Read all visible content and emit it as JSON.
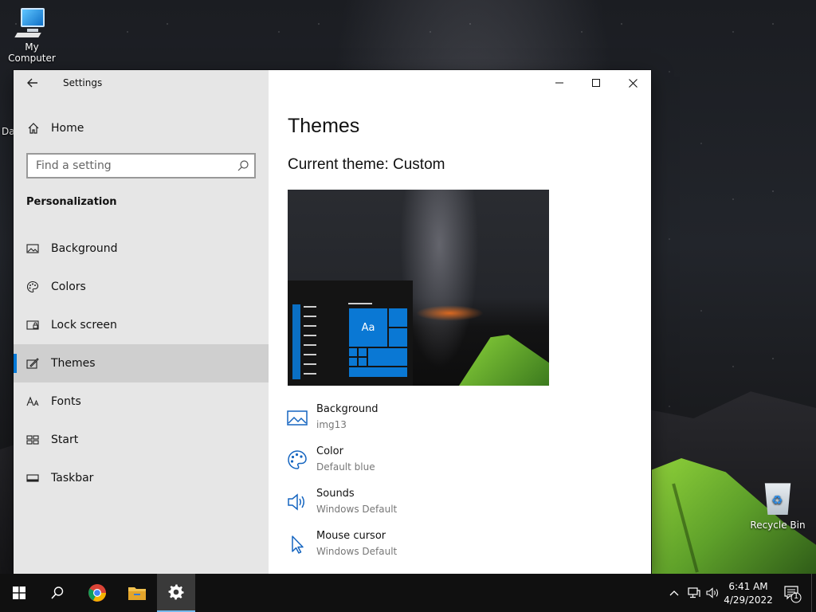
{
  "desktop": {
    "my_computer_label": "My Computer",
    "recycle_bin_label": "Recycle Bin",
    "partial_icon_label": "Da"
  },
  "window": {
    "app_title": "Settings",
    "home_label": "Home",
    "search": {
      "placeholder": "Find a setting",
      "value": ""
    },
    "section_heading": "Personalization",
    "nav_items": [
      {
        "label": "Background",
        "icon": "image-icon"
      },
      {
        "label": "Colors",
        "icon": "palette-icon"
      },
      {
        "label": "Lock screen",
        "icon": "lock-screen-icon"
      },
      {
        "label": "Themes",
        "icon": "themes-icon",
        "selected": true
      },
      {
        "label": "Fonts",
        "icon": "fonts-icon"
      },
      {
        "label": "Start",
        "icon": "start-icon"
      },
      {
        "label": "Taskbar",
        "icon": "taskbar-icon"
      }
    ],
    "content": {
      "page_title": "Themes",
      "current_theme": "Current theme: Custom",
      "preview_tile_text": "Aa",
      "properties": [
        {
          "name": "Background",
          "value": "img13",
          "icon": "image-icon"
        },
        {
          "name": "Color",
          "value": "Default blue",
          "icon": "palette-icon"
        },
        {
          "name": "Sounds",
          "value": "Windows Default",
          "icon": "speaker-icon"
        },
        {
          "name": "Mouse cursor",
          "value": "Windows Default",
          "icon": "cursor-icon"
        }
      ]
    }
  },
  "taskbar": {
    "time": "6:41 AM",
    "date": "4/29/2022",
    "notification_count": "1"
  },
  "colors": {
    "accent": "#0078d7",
    "sidebar_bg": "#e6e6e6",
    "taskbar_bg": "#101010"
  }
}
